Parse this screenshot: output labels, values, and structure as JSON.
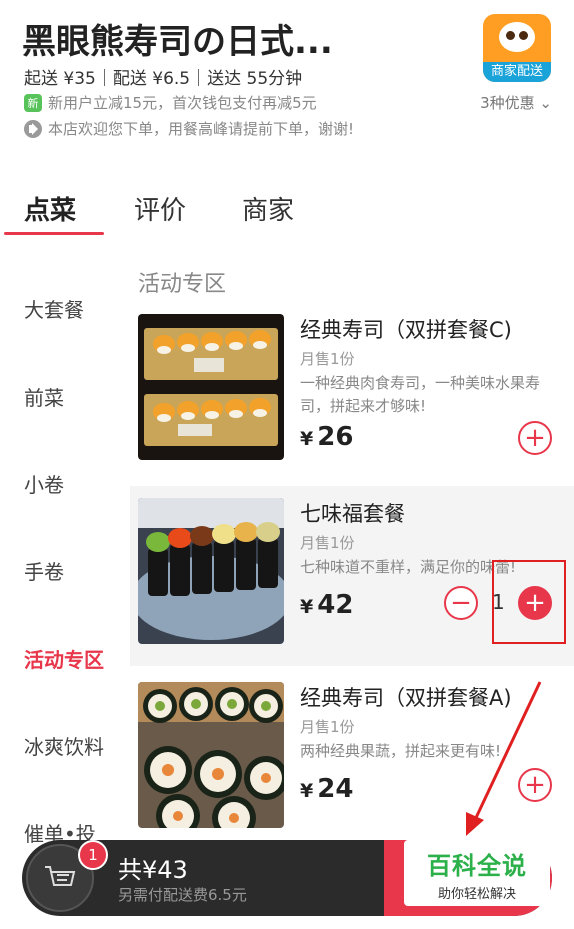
{
  "header": {
    "store_name": "黑眼熊寿司の日式...",
    "meta": "起送 ¥35｜配送 ¥6.5｜送达 55分钟",
    "promo_new_badge": "新",
    "promo_new_text": "新用户立减15元，首次钱包支付再减5元",
    "notice_text": "本店欢迎您下单，用餐高峰请提前下单，谢谢!",
    "promo_more": "3种优惠 ⌄",
    "logo_label": "商家配送"
  },
  "tabs": [
    {
      "label": "点菜",
      "active": true
    },
    {
      "label": "评价",
      "active": false
    },
    {
      "label": "商家",
      "active": false
    }
  ],
  "sidebar": {
    "items": [
      {
        "label": "大套餐",
        "active": false
      },
      {
        "label": "前菜",
        "active": false
      },
      {
        "label": "小卷",
        "active": false
      },
      {
        "label": "手卷",
        "active": false
      },
      {
        "label": "活动专区",
        "active": true
      },
      {
        "label": "冰爽饮料",
        "active": false
      },
      {
        "label": "催单•投",
        "active": false
      }
    ]
  },
  "section": {
    "title": "活动专区"
  },
  "items": [
    {
      "name": "经典寿司（双拼套餐C)",
      "sold": "月售1份",
      "desc": "一种经典肉食寿司，一种美味水果寿司，拼起来才够味!",
      "currency": "¥",
      "price": "26",
      "quantity": ""
    },
    {
      "name": "七味福套餐",
      "sold": "月售1份",
      "desc": "七种味道不重样，满足你的味蕾!",
      "currency": "¥",
      "price": "42",
      "quantity": "1"
    },
    {
      "name": "经典寿司（双拼套餐A)",
      "sold": "月售1份",
      "desc": "两种经典果蔬，拼起来更有味!",
      "currency": "¥",
      "price": "24",
      "quantity": ""
    }
  ],
  "cart": {
    "badge_count": "1",
    "total": "共¥43",
    "fee": "另需付配送费6.5元"
  },
  "watermark": {
    "main": "百科全说",
    "sub": "助你轻松解决"
  },
  "colors": {
    "accent": "#e8374b",
    "cart_bg": "#2b2b2b",
    "watermark_green": "#2bb04a",
    "annotation_red": "#e02020"
  }
}
